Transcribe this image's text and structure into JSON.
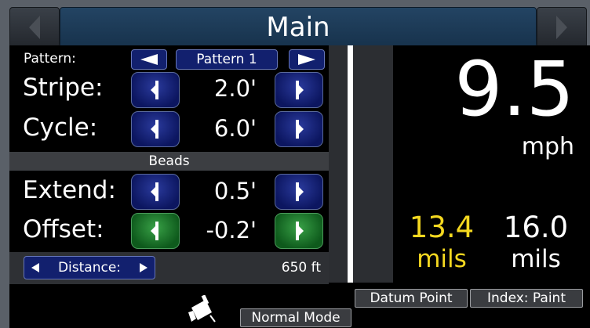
{
  "header": {
    "title": "Main"
  },
  "pattern": {
    "label": "Pattern:",
    "name": "Pattern 1"
  },
  "stripe": {
    "label": "Stripe:",
    "value": "2.0'"
  },
  "cycle": {
    "label": "Cycle:",
    "value": "6.0'"
  },
  "beads": {
    "section_label": "Beads"
  },
  "extend": {
    "label": "Extend:",
    "value": "0.5'"
  },
  "offset": {
    "label": "Offset:",
    "value": "-0.2'"
  },
  "distance": {
    "label": "Distance:",
    "value": "650 ft"
  },
  "speed": {
    "value": "9.5",
    "unit": "mph"
  },
  "thickness_left": {
    "value": "13.4",
    "unit": "mils"
  },
  "thickness_right": {
    "value": "16.0",
    "unit": "mils"
  },
  "buttons": {
    "datum_point": "Datum Point",
    "index": "Index: Paint",
    "mode": "Normal Mode"
  },
  "colors": {
    "accent_blue": "#12206e",
    "offset_green": "#38a046",
    "mils_yellow": "#f4d820"
  },
  "icons": {
    "prev": "chevron-left-icon",
    "next": "chevron-right-icon",
    "paint": "paint-gun-icon"
  }
}
